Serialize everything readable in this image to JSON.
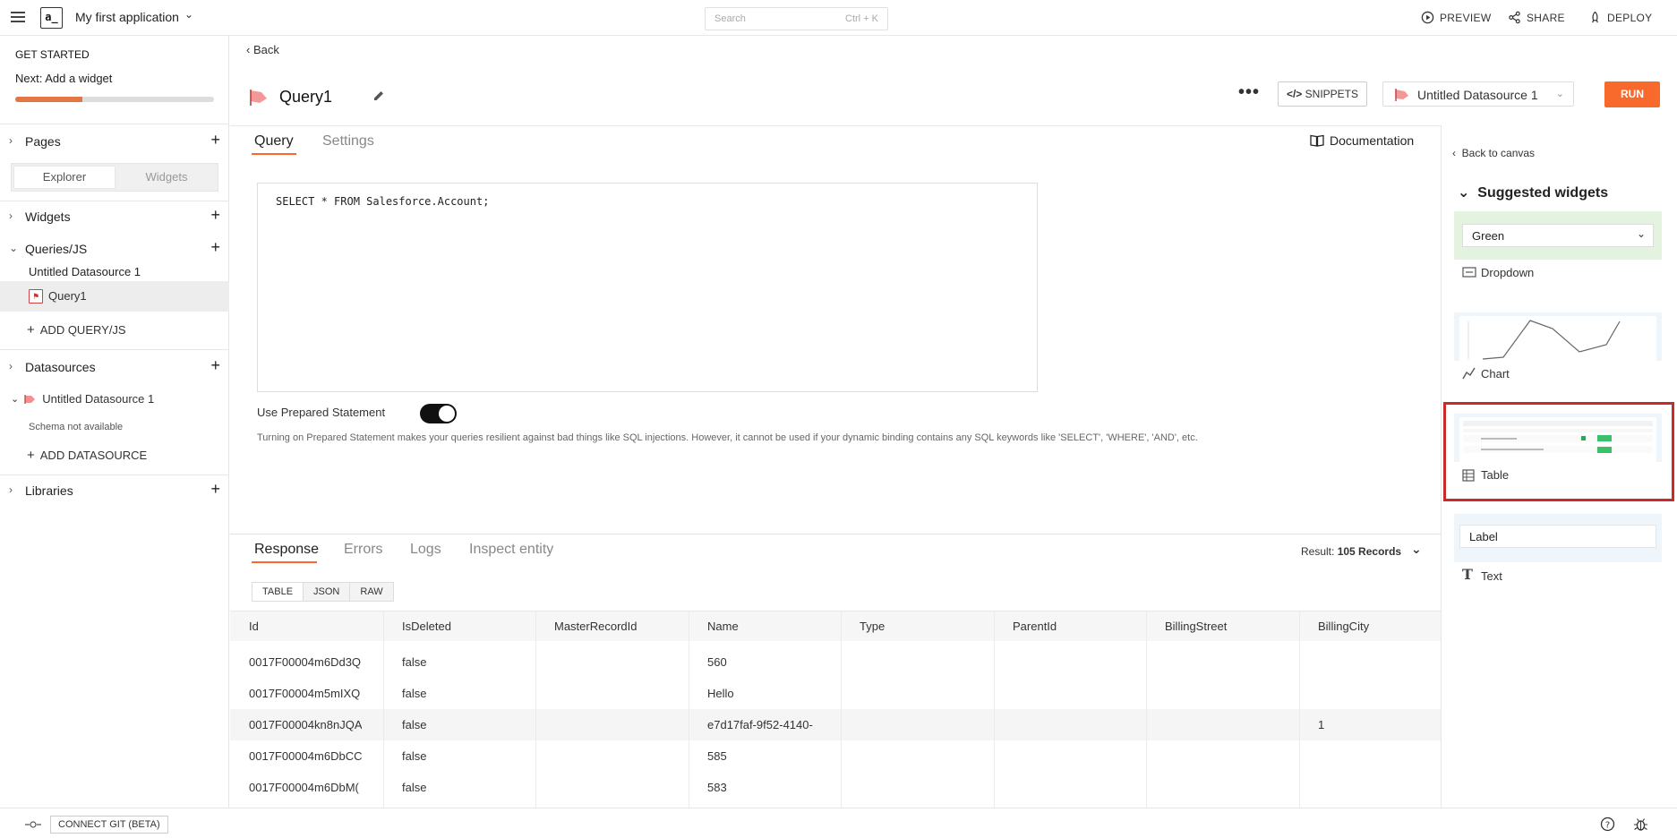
{
  "topbar": {
    "logo": "a_",
    "app_name": "My first application",
    "search_placeholder": "Search",
    "search_shortcut": "Ctrl + K",
    "preview": "PREVIEW",
    "share": "SHARE",
    "deploy": "DEPLOY"
  },
  "sidebar": {
    "get_started": "GET STARTED",
    "next": "Next: Add a widget",
    "progress": 0.34,
    "pages": "Pages",
    "explorer": "Explorer",
    "widgets_tab": "Widgets",
    "widgets": "Widgets",
    "queries": "Queries/JS",
    "datasource_group": "Untitled Datasource 1",
    "query_item": "Query1",
    "add_query": "ADD QUERY/JS",
    "datasources": "Datasources",
    "datasource_item": "Untitled Datasource 1",
    "schema_na": "Schema not available",
    "add_datasource": "ADD DATASOURCE",
    "libraries": "Libraries"
  },
  "header": {
    "back": "Back",
    "query_name": "Query1",
    "more": "•••",
    "snippets": "SNIPPETS",
    "datasource": "Untitled Datasource 1",
    "run": "RUN"
  },
  "tabs": {
    "query": "Query",
    "settings": "Settings",
    "documentation": "Documentation"
  },
  "editor": {
    "code": "SELECT * FROM Salesforce.Account;",
    "prepared_label": "Use Prepared Statement",
    "prepared_on": true,
    "prepared_help": "Turning on Prepared Statement makes your queries resilient against bad things like SQL injections. However, it cannot be used if your dynamic binding contains any SQL keywords like 'SELECT', 'WHERE', 'AND', etc."
  },
  "response": {
    "tabs": [
      "Response",
      "Errors",
      "Logs",
      "Inspect entity"
    ],
    "result_label": "Result:",
    "result_value": "105 Records",
    "view_modes": [
      "TABLE",
      "JSON",
      "RAW"
    ],
    "columns": [
      "Id",
      "IsDeleted",
      "MasterRecordId",
      "Name",
      "Type",
      "ParentId",
      "BillingStreet",
      "BillingCity"
    ],
    "rows": [
      [
        "0017F00004m6Dd3Q",
        "false",
        "",
        "560",
        "",
        "",
        "",
        ""
      ],
      [
        "0017F00004m5mIXQ",
        "false",
        "",
        "Hello",
        "",
        "",
        "",
        ""
      ],
      [
        "0017F00004kn8nJQA",
        "false",
        "",
        "e7d17faf-9f52-4140-",
        "",
        "",
        "",
        "1"
      ],
      [
        "0017F00004m6DbCC",
        "false",
        "",
        "585",
        "",
        "",
        "",
        ""
      ],
      [
        "0017F00004m6DbM(",
        "false",
        "",
        "583",
        "",
        "",
        "",
        ""
      ]
    ]
  },
  "right_panel": {
    "back": "Back to canvas",
    "title": "Suggested widgets",
    "dropdown_value": "Green",
    "dropdown": "Dropdown",
    "chart": "Chart",
    "table": "Table",
    "text_preview": "Label",
    "text": "Text"
  },
  "bottombar": {
    "connect_git": "CONNECT GIT (BETA)"
  },
  "colors": {
    "accent": "#f86a2b",
    "highlight": "#cc2a2a"
  }
}
